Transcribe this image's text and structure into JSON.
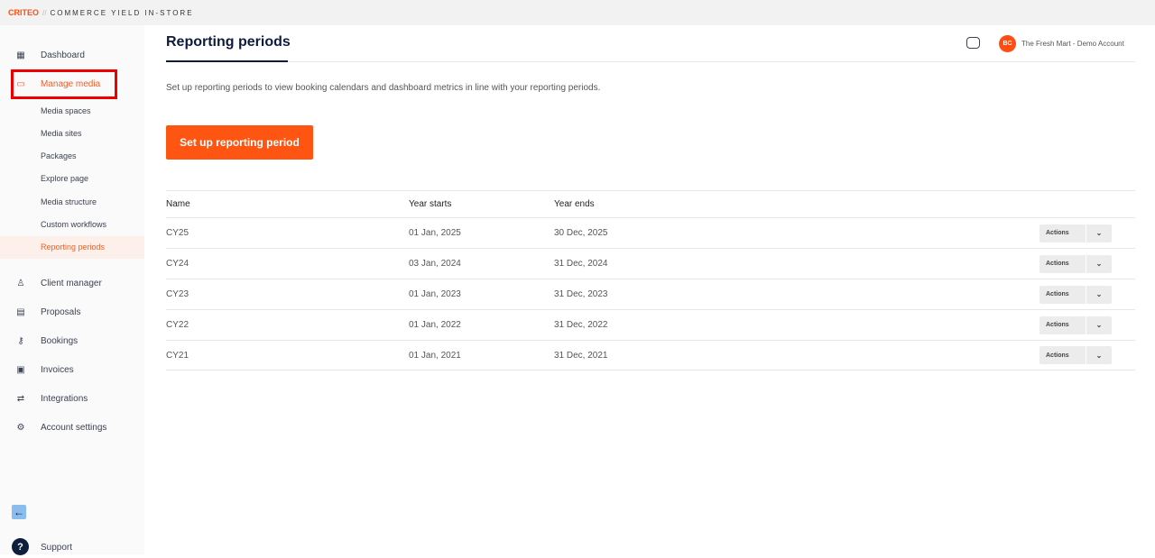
{
  "topbar": {
    "logo": "CRITEO",
    "separator": "//",
    "product": "COMMERCE YIELD IN-STORE"
  },
  "sidebar": {
    "items": [
      {
        "label": "Dashboard",
        "icon": "grid-icon"
      },
      {
        "label": "Manage media",
        "icon": "monitor-icon",
        "active": true
      },
      {
        "label": "Client manager",
        "icon": "user-icon"
      },
      {
        "label": "Proposals",
        "icon": "proposal-icon"
      },
      {
        "label": "Bookings",
        "icon": "key-icon"
      },
      {
        "label": "Invoices",
        "icon": "invoice-icon"
      },
      {
        "label": "Integrations",
        "icon": "arrows-icon"
      },
      {
        "label": "Account settings",
        "icon": "gear-icon"
      }
    ],
    "subitems": [
      "Media spaces",
      "Media sites",
      "Packages",
      "Explore page",
      "Media structure",
      "Custom workflows",
      "Reporting periods"
    ],
    "support": "Support"
  },
  "header": {
    "title": "Reporting periods",
    "avatar": "BC",
    "account": "The Fresh Mart - Demo Account"
  },
  "main": {
    "description": "Set up reporting periods to view booking calendars and dashboard metrics in line with your reporting periods.",
    "cta": "Set up reporting period",
    "columns": [
      "Name",
      "Year starts",
      "Year ends"
    ],
    "actions_label": "Actions",
    "rows": [
      {
        "name": "CY25",
        "start": "01 Jan, 2025",
        "end": "30 Dec, 2025"
      },
      {
        "name": "CY24",
        "start": "03 Jan, 2024",
        "end": "31 Dec, 2024"
      },
      {
        "name": "CY23",
        "start": "01 Jan, 2023",
        "end": "31 Dec, 2023"
      },
      {
        "name": "CY22",
        "start": "01 Jan, 2022",
        "end": "31 Dec, 2022"
      },
      {
        "name": "CY21",
        "start": "01 Jan, 2021",
        "end": "31 Dec, 2021"
      }
    ]
  },
  "colors": {
    "accent": "#ff5512",
    "navy": "#0d1b3e"
  }
}
